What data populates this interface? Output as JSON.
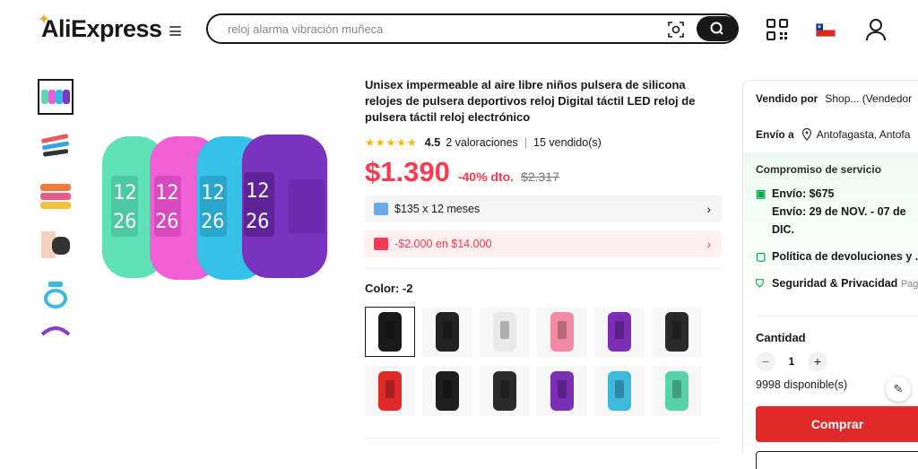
{
  "header": {
    "logo": "AliExpress",
    "search_placeholder": "reloj alarma vibración muñeca"
  },
  "product": {
    "title": "Unisex impermeable al aire libre niños pulsera de silicona relojes de pulsera deportivos reloj Digital táctil LED reloj de pulsera táctil reloj electrónico",
    "rating_stars": "★★★★★",
    "rating": "4.5",
    "reviews": "2 valoraciones",
    "sold": "15 vendido(s)",
    "price": "$1.390",
    "discount": "-40% dto.",
    "original_price": "$2.317",
    "installments": "$135 x 12 meses",
    "coupon": "-$2.000 en $14.000",
    "color_label": "Color: -2",
    "swatches": [
      "#1a1a1a",
      "#222222",
      "#e8e8e8",
      "#f28aa4",
      "#7b2fb5",
      "#2a2a2a",
      "#e02a2a",
      "#1e1e1e",
      "#2b2b2b",
      "#7b2fb5",
      "#3cb9dc",
      "#56d3a8"
    ],
    "thumb_colors": [
      "#6ad0c0",
      "#e85a5a",
      "#f07a3a",
      "#333333",
      "#3cb9dc",
      "#8a3fc8"
    ]
  },
  "seller_panel": {
    "sold_by_label": "Vendido por",
    "sold_by_value": "Shop... (Vendedor",
    "ship_to_label": "Envío a",
    "ship_to_value": "Antofagasta, Antofa",
    "commitment_title": "Compromiso de servicio",
    "shipping_cost": "Envío: $675",
    "shipping_dates": "Envío: 29 de NOV. - 07 de DIC.",
    "returns": "Política de devoluciones y ...",
    "security": "Seguridad & Privacidad",
    "security_more": "Pag...",
    "quantity_label": "Cantidad",
    "quantity_minus": "−",
    "quantity_value": "1",
    "quantity_plus": "+",
    "available": "9998 disponible(s)",
    "buy_button": "Comprar"
  },
  "colors": {
    "accent": "#fd384f",
    "buy": "#e02a2a",
    "green": "#00a54f"
  }
}
